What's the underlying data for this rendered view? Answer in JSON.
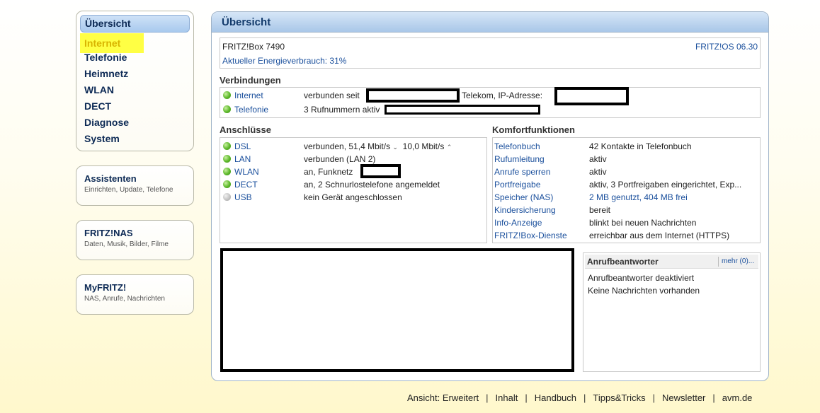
{
  "nav": {
    "items": [
      {
        "label": "Übersicht",
        "state": "active"
      },
      {
        "label": "Internet",
        "state": "highlight"
      },
      {
        "label": "Telefonie"
      },
      {
        "label": "Heimnetz"
      },
      {
        "label": "WLAN"
      },
      {
        "label": "DECT"
      },
      {
        "label": "Diagnose"
      },
      {
        "label": "System"
      }
    ],
    "cards": [
      {
        "title": "Assistenten",
        "sub": "Einrichten, Update, Telefone"
      },
      {
        "title": "FRITZ!NAS",
        "sub": "Daten, Musik, Bilder, Filme"
      },
      {
        "title": "MyFRITZ!",
        "sub": "NAS, Anrufe, Nachrichten"
      }
    ]
  },
  "main": {
    "title": "Übersicht",
    "device": "FRITZ!Box 7490",
    "os": "FRITZ!OS 06.30",
    "energy": "Aktueller Energieverbrauch: 31%"
  },
  "connections": {
    "title": "Verbindungen",
    "internet_label": "Internet",
    "internet_status": "verbunden seit",
    "internet_provider": "Telekom, IP-Adresse:",
    "telefonie_label": "Telefonie",
    "telefonie_status": "3 Rufnummern aktiv"
  },
  "ports": {
    "title": "Anschlüsse",
    "rows": [
      {
        "label": "DSL",
        "value": "verbunden, 51,4 Mbit/s",
        "value2": "10,0 Mbit/s",
        "status": "green"
      },
      {
        "label": "LAN",
        "value": "verbunden (LAN 2)",
        "status": "green"
      },
      {
        "label": "WLAN",
        "value": "an, Funknetz",
        "status": "green"
      },
      {
        "label": "DECT",
        "value": "an, 2 Schnurlostelefone angemeldet",
        "status": "green"
      },
      {
        "label": "USB",
        "value": "kein Gerät angeschlossen",
        "status": "grey"
      }
    ],
    "arrow_down": "⌄",
    "arrow_up": "⌃"
  },
  "comfort": {
    "title": "Komfortfunktionen",
    "rows": [
      {
        "label": "Telefonbuch",
        "value": "42 Kontakte in Telefonbuch"
      },
      {
        "label": "Rufumleitung",
        "value": "aktiv"
      },
      {
        "label": "Anrufe sperren",
        "value": "aktiv"
      },
      {
        "label": "Portfreigabe",
        "value": "aktiv, 3 Portfreigaben eingerichtet, Exp..."
      },
      {
        "label": "Speicher (NAS)",
        "value": "2 MB genutzt, 404 MB frei"
      },
      {
        "label": "Kindersicherung",
        "value": "bereit"
      },
      {
        "label": "Info-Anzeige",
        "value": "blinkt bei neuen Nachrichten"
      },
      {
        "label": "FRITZ!Box-Dienste",
        "value": "erreichbar aus dem Internet (HTTPS)"
      }
    ]
  },
  "answering": {
    "title": "Anrufbeantworter",
    "more": "mehr (0)...",
    "line1": "Anrufbeantworter deaktiviert",
    "line2": "Keine Nachrichten vorhanden"
  },
  "footer": {
    "links": [
      "Ansicht: Erweitert",
      "Inhalt",
      "Handbuch",
      "Tipps&Tricks",
      "Newsletter",
      "avm.de"
    ],
    "separator": "|"
  }
}
